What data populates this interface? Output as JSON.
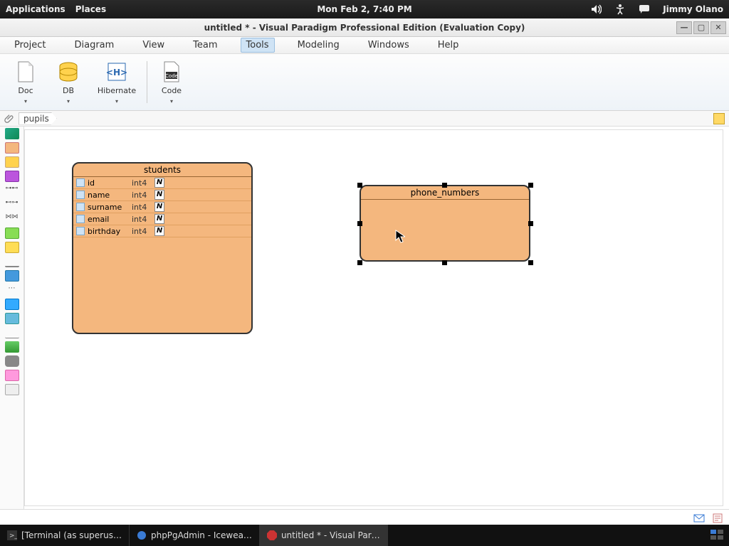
{
  "gnome": {
    "apps": "Applications",
    "places": "Places",
    "clock": "Mon Feb  2,  7:40 PM",
    "user": "Jimmy Olano"
  },
  "window": {
    "title": "untitled * - Visual Paradigm Professional Edition (Evaluation Copy)"
  },
  "menu": {
    "items": [
      "Project",
      "Diagram",
      "View",
      "Team",
      "Tools",
      "Modeling",
      "Windows",
      "Help"
    ],
    "active_index": 4
  },
  "toolbar": {
    "doc": "Doc",
    "db": "DB",
    "hibernate": "Hibernate",
    "code": "Code"
  },
  "breadcrumb": {
    "item": "pupils"
  },
  "entities": {
    "students": {
      "title": "students",
      "cols": [
        {
          "name": "id",
          "type": "int4"
        },
        {
          "name": "name",
          "type": "int4"
        },
        {
          "name": "surname",
          "type": "int4"
        },
        {
          "name": "email",
          "type": "int4"
        },
        {
          "name": "birthday",
          "type": "int4"
        }
      ]
    },
    "phone_numbers": {
      "title": "phone_numbers"
    }
  },
  "nn_glyph": "N",
  "taskbar": {
    "t1": "[Terminal (as superus…",
    "t2": "phpPgAdmin - Icewea…",
    "t3": "untitled * - Visual Par…"
  }
}
